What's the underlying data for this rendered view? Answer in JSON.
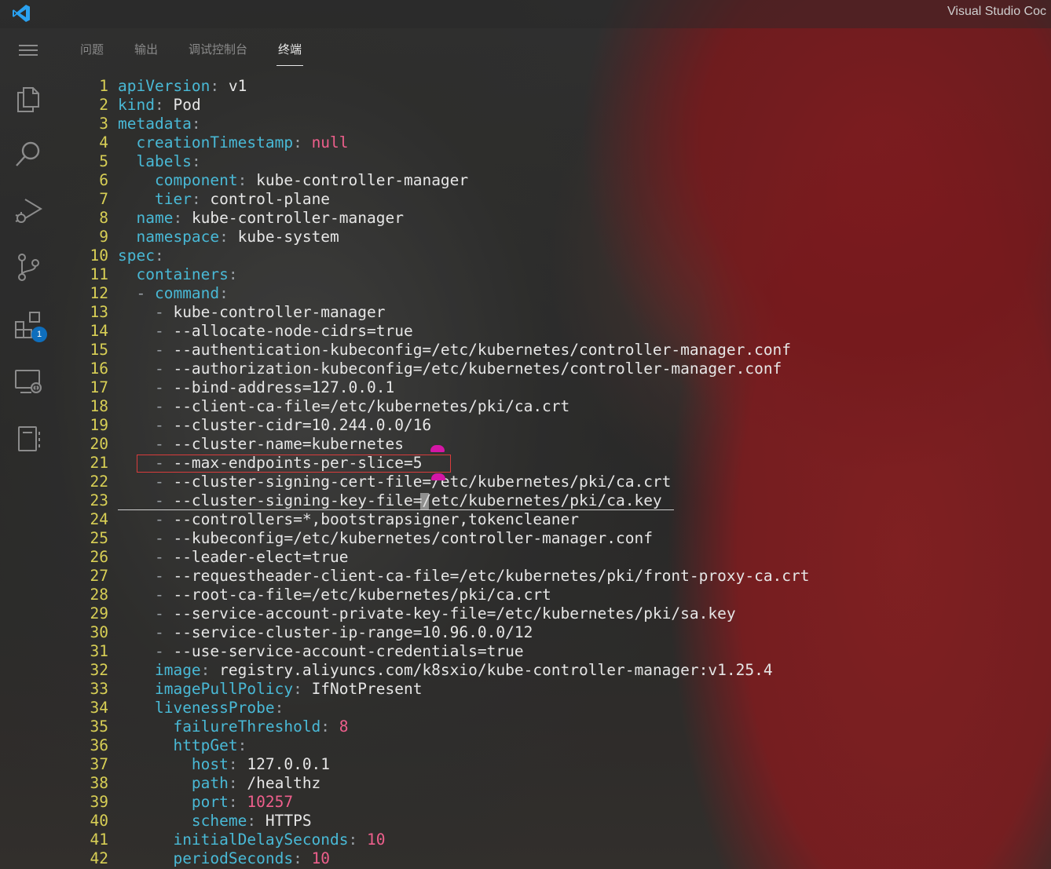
{
  "window": {
    "title": "Visual Studio Coc",
    "logo": "vscode-logo"
  },
  "activity_bar": {
    "items": [
      {
        "name": "menu-icon"
      },
      {
        "name": "explorer-icon"
      },
      {
        "name": "search-icon"
      },
      {
        "name": "run-debug-icon"
      },
      {
        "name": "source-control-icon"
      },
      {
        "name": "extensions-icon",
        "badge": "1"
      },
      {
        "name": "remote-explorer-icon"
      },
      {
        "name": "notebook-icon"
      }
    ],
    "badge_color": "#0e6ebd"
  },
  "panel": {
    "tabs": [
      {
        "label": "问题",
        "active": false
      },
      {
        "label": "输出",
        "active": false
      },
      {
        "label": "调试控制台",
        "active": false
      },
      {
        "label": "终端",
        "active": true
      }
    ]
  },
  "editor": {
    "highlighted_line": 21,
    "cursor_line": 23,
    "lines": [
      {
        "num": "1",
        "indent": "",
        "dash": "",
        "key": "apiVersion",
        "value": " v1",
        "vtype": "v"
      },
      {
        "num": "2",
        "indent": "",
        "dash": "",
        "key": "kind",
        "value": " Pod",
        "vtype": "v"
      },
      {
        "num": "3",
        "indent": "",
        "dash": "",
        "key": "metadata",
        "value": "",
        "vtype": "v"
      },
      {
        "num": "4",
        "indent": "  ",
        "dash": "",
        "key": "creationTimestamp",
        "value": " null",
        "vtype": "n"
      },
      {
        "num": "5",
        "indent": "  ",
        "dash": "",
        "key": "labels",
        "value": "",
        "vtype": "v"
      },
      {
        "num": "6",
        "indent": "    ",
        "dash": "",
        "key": "component",
        "value": " kube-controller-manager",
        "vtype": "v"
      },
      {
        "num": "7",
        "indent": "    ",
        "dash": "",
        "key": "tier",
        "value": " control-plane",
        "vtype": "v"
      },
      {
        "num": "8",
        "indent": "  ",
        "dash": "",
        "key": "name",
        "value": " kube-controller-manager",
        "vtype": "v"
      },
      {
        "num": "9",
        "indent": "  ",
        "dash": "",
        "key": "namespace",
        "value": " kube-system",
        "vtype": "v"
      },
      {
        "num": "10",
        "indent": "",
        "dash": "",
        "key": "spec",
        "value": "",
        "vtype": "v"
      },
      {
        "num": "11",
        "indent": "  ",
        "dash": "",
        "key": "containers",
        "value": "",
        "vtype": "v"
      },
      {
        "num": "12",
        "indent": "  ",
        "dash": "- ",
        "key": "command",
        "value": "",
        "vtype": "v"
      },
      {
        "num": "13",
        "indent": "    ",
        "dash": "- ",
        "key": "",
        "value": "kube-controller-manager",
        "vtype": "v"
      },
      {
        "num": "14",
        "indent": "    ",
        "dash": "- ",
        "key": "",
        "value": "--allocate-node-cidrs=true",
        "vtype": "v"
      },
      {
        "num": "15",
        "indent": "    ",
        "dash": "- ",
        "key": "",
        "value": "--authentication-kubeconfig=/etc/kubernetes/controller-manager.conf",
        "vtype": "v"
      },
      {
        "num": "16",
        "indent": "    ",
        "dash": "- ",
        "key": "",
        "value": "--authorization-kubeconfig=/etc/kubernetes/controller-manager.conf",
        "vtype": "v"
      },
      {
        "num": "17",
        "indent": "    ",
        "dash": "- ",
        "key": "",
        "value": "--bind-address=127.0.0.1",
        "vtype": "v"
      },
      {
        "num": "18",
        "indent": "    ",
        "dash": "- ",
        "key": "",
        "value": "--client-ca-file=/etc/kubernetes/pki/ca.crt",
        "vtype": "v"
      },
      {
        "num": "19",
        "indent": "    ",
        "dash": "- ",
        "key": "",
        "value": "--cluster-cidr=10.244.0.0/16",
        "vtype": "v"
      },
      {
        "num": "20",
        "indent": "    ",
        "dash": "- ",
        "key": "",
        "value": "--cluster-name=kubernetes",
        "vtype": "v"
      },
      {
        "num": "21",
        "indent": "    ",
        "dash": "- ",
        "key": "",
        "value": "--max-endpoints-per-slice=5",
        "vtype": "v"
      },
      {
        "num": "22",
        "indent": "    ",
        "dash": "- ",
        "key": "",
        "value": "--cluster-signing-cert-file=/etc/kubernetes/pki/ca.crt",
        "vtype": "v"
      },
      {
        "num": "23",
        "indent": "    ",
        "dash": "- ",
        "key": "",
        "value": "--cluster-signing-key-file=/etc/kubernetes/pki/ca.key",
        "vtype": "v"
      },
      {
        "num": "24",
        "indent": "    ",
        "dash": "- ",
        "key": "",
        "value": "--controllers=*,bootstrapsigner,tokencleaner",
        "vtype": "v"
      },
      {
        "num": "25",
        "indent": "    ",
        "dash": "- ",
        "key": "",
        "value": "--kubeconfig=/etc/kubernetes/controller-manager.conf",
        "vtype": "v"
      },
      {
        "num": "26",
        "indent": "    ",
        "dash": "- ",
        "key": "",
        "value": "--leader-elect=true",
        "vtype": "v"
      },
      {
        "num": "27",
        "indent": "    ",
        "dash": "- ",
        "key": "",
        "value": "--requestheader-client-ca-file=/etc/kubernetes/pki/front-proxy-ca.crt",
        "vtype": "v"
      },
      {
        "num": "28",
        "indent": "    ",
        "dash": "- ",
        "key": "",
        "value": "--root-ca-file=/etc/kubernetes/pki/ca.crt",
        "vtype": "v"
      },
      {
        "num": "29",
        "indent": "    ",
        "dash": "- ",
        "key": "",
        "value": "--service-account-private-key-file=/etc/kubernetes/pki/sa.key",
        "vtype": "v"
      },
      {
        "num": "30",
        "indent": "    ",
        "dash": "- ",
        "key": "",
        "value": "--service-cluster-ip-range=10.96.0.0/12",
        "vtype": "v"
      },
      {
        "num": "31",
        "indent": "    ",
        "dash": "- ",
        "key": "",
        "value": "--use-service-account-credentials=true",
        "vtype": "v"
      },
      {
        "num": "32",
        "indent": "    ",
        "dash": "",
        "key": "image",
        "value": " registry.aliyuncs.com/k8sxio/kube-controller-manager:v1.25.4",
        "vtype": "v"
      },
      {
        "num": "33",
        "indent": "    ",
        "dash": "",
        "key": "imagePullPolicy",
        "value": " IfNotPresent",
        "vtype": "v"
      },
      {
        "num": "34",
        "indent": "    ",
        "dash": "",
        "key": "livenessProbe",
        "value": "",
        "vtype": "v"
      },
      {
        "num": "35",
        "indent": "      ",
        "dash": "",
        "key": "failureThreshold",
        "value": " 8",
        "vtype": "n"
      },
      {
        "num": "36",
        "indent": "      ",
        "dash": "",
        "key": "httpGet",
        "value": "",
        "vtype": "v"
      },
      {
        "num": "37",
        "indent": "        ",
        "dash": "",
        "key": "host",
        "value": " 127.0.0.1",
        "vtype": "v"
      },
      {
        "num": "38",
        "indent": "        ",
        "dash": "",
        "key": "path",
        "value": " /healthz",
        "vtype": "v"
      },
      {
        "num": "39",
        "indent": "        ",
        "dash": "",
        "key": "port",
        "value": " 10257",
        "vtype": "n"
      },
      {
        "num": "40",
        "indent": "        ",
        "dash": "",
        "key": "scheme",
        "value": " HTTPS",
        "vtype": "v"
      },
      {
        "num": "41",
        "indent": "      ",
        "dash": "",
        "key": "initialDelaySeconds",
        "value": " 10",
        "vtype": "n"
      },
      {
        "num": "42",
        "indent": "      ",
        "dash": "",
        "key": "periodSeconds",
        "value": " 10",
        "vtype": "n"
      }
    ]
  }
}
